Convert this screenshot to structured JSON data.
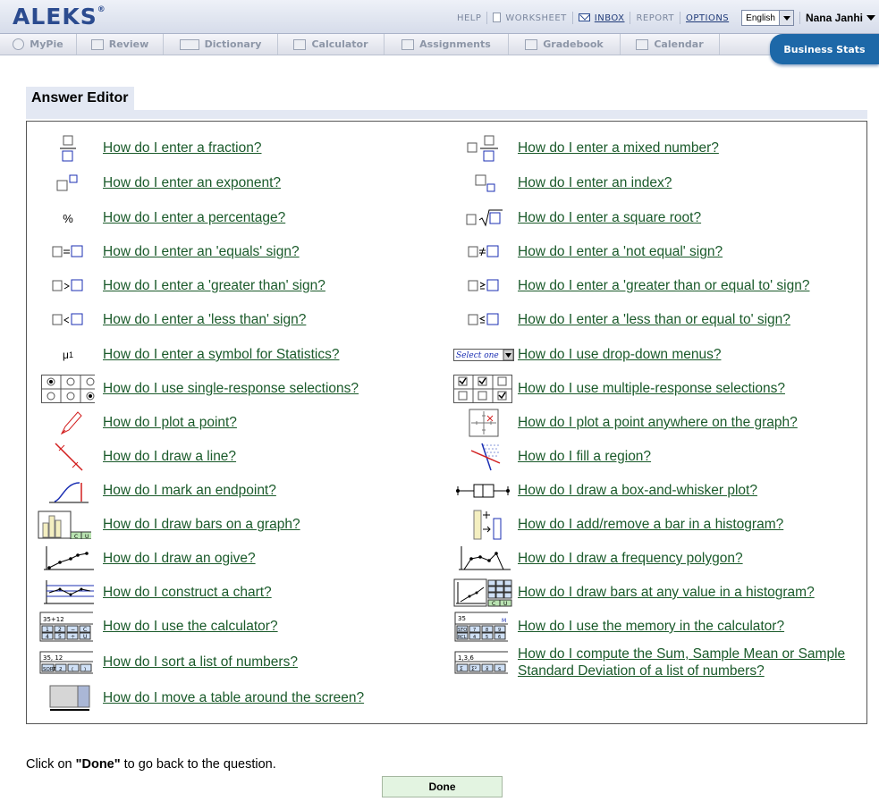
{
  "header": {
    "logo": "ALEKS",
    "logo_mark": "®",
    "links": {
      "help": "HELP",
      "worksheet": "WORKSHEET",
      "inbox": "INBOX",
      "report": "REPORT",
      "options": "OPTIONS"
    },
    "language": "English",
    "user_name": "Nana Janhi"
  },
  "tabs": [
    "MyPie",
    "Review",
    "Dictionary",
    "Calculator",
    "Assignments",
    "Gradebook",
    "Calendar"
  ],
  "class_tab": "Business Stats",
  "editor": {
    "title": "Answer Editor",
    "left": [
      {
        "icon": "fraction-icon",
        "label": "How do I enter a fraction?"
      },
      {
        "icon": "exponent-icon",
        "label": "How do I enter an exponent?"
      },
      {
        "icon": "percent-icon",
        "label": "How do I enter a percentage?"
      },
      {
        "icon": "equals-icon",
        "label": "How do I enter an 'equals' sign?"
      },
      {
        "icon": "greater-than-icon",
        "label": "How do I enter a 'greater than' sign?"
      },
      {
        "icon": "less-than-icon",
        "label": "How do I enter a 'less than' sign?"
      },
      {
        "icon": "statistics-symbol-icon",
        "label": "How do I enter a symbol for Statistics?"
      },
      {
        "icon": "radio-buttons-icon",
        "label": "How do I use single-response selections?"
      },
      {
        "icon": "pencil-icon",
        "label": "How do I plot a point?"
      },
      {
        "icon": "line-icon",
        "label": "How do I draw a line?"
      },
      {
        "icon": "endpoint-icon",
        "label": "How do I mark an endpoint?"
      },
      {
        "icon": "bar-graph-icon",
        "label": "How do I draw bars on a graph?"
      },
      {
        "icon": "ogive-icon",
        "label": "How do I draw an ogive?"
      },
      {
        "icon": "chart-icon",
        "label": "How do I construct a chart?"
      },
      {
        "icon": "calculator-icon",
        "label": "How do I use the calculator?"
      },
      {
        "icon": "sort-icon",
        "label": "How do I sort a list of numbers?"
      },
      {
        "icon": "move-table-icon",
        "label": "How do I move a table around the screen?"
      }
    ],
    "right": [
      {
        "icon": "mixed-number-icon",
        "label": "How do I enter a mixed number?"
      },
      {
        "icon": "index-icon",
        "label": "How do I enter an index?"
      },
      {
        "icon": "square-root-icon",
        "label": "How do I enter a square root?"
      },
      {
        "icon": "not-equal-icon",
        "label": "How do I enter a 'not equal' sign?"
      },
      {
        "icon": "greater-equal-icon",
        "label": "How do I enter a 'greater than or equal to' sign?"
      },
      {
        "icon": "less-equal-icon",
        "label": "How do I enter a 'less than or equal to' sign?"
      },
      {
        "icon": "dropdown-icon",
        "label": "How do I use drop-down menus?"
      },
      {
        "icon": "checkboxes-icon",
        "label": "How do I use multiple-response selections?"
      },
      {
        "icon": "plot-anywhere-icon",
        "label": "How do I plot a point anywhere on the graph?"
      },
      {
        "icon": "fill-region-icon",
        "label": "How do I fill a region?"
      },
      {
        "icon": "box-whisker-icon",
        "label": "How do I draw a box-and-whisker plot?"
      },
      {
        "icon": "histogram-bar-icon",
        "label": "How do I add/remove a bar in a histogram?"
      },
      {
        "icon": "frequency-polygon-icon",
        "label": "How do I draw a frequency polygon?"
      },
      {
        "icon": "histogram-any-icon",
        "label": "How do I draw bars at any value in a histogram?"
      },
      {
        "icon": "calculator-memory-icon",
        "label": "How do I use the memory in the calculator?"
      },
      {
        "icon": "sum-mean-icon",
        "label": "How do I compute the Sum, Sample Mean or Sample Standard Deviation of a list of numbers?"
      }
    ],
    "icon_text": {
      "percent": "%",
      "mu": "μ",
      "mu_sub": "1",
      "select_one": "Select one",
      "calc_display": "35+12",
      "calc_keys": [
        "1",
        "2",
        "−",
        "C",
        "4",
        "5",
        "÷",
        "U"
      ],
      "mem_display": "35",
      "mem_flag": "M",
      "mem_keys": [
        "STO",
        "7",
        "8",
        "9",
        "RCL",
        "4",
        "5",
        "6"
      ],
      "sort_display": "35, 12",
      "sort_keys": [
        "SORT",
        "2",
        "(",
        ")"
      ],
      "sum_display": "1,3,6",
      "sum_keys": [
        "Σ",
        "Σ²",
        "x̄",
        "s"
      ],
      "bar_keys": [
        "C",
        "U"
      ],
      "hist_keys": [
        "C",
        "U"
      ]
    }
  },
  "footer": {
    "text_before": "Click on ",
    "text_bold": "\"Done\"",
    "text_after": " to go back to the question.",
    "done_button": "Done"
  }
}
